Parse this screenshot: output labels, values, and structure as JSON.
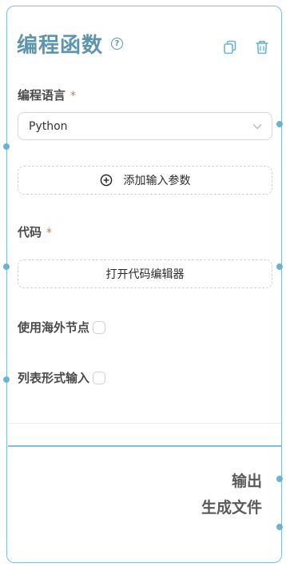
{
  "node": {
    "title": "编程函数",
    "help_icon": "question-circle-icon",
    "toolbar": {
      "copy_icon": "copy-icon",
      "delete_icon": "trash-icon"
    }
  },
  "language": {
    "label": "编程语言",
    "required_mark": "*",
    "selected": "Python"
  },
  "add_param": {
    "icon": "plus-circle-icon",
    "label": "添加输入参数"
  },
  "code": {
    "label": "代码",
    "required_mark": "*",
    "open_editor_label": "打开代码编辑器"
  },
  "options": [
    {
      "label": "使用海外节点",
      "checked": false
    },
    {
      "label": "列表形式输入",
      "checked": false
    }
  ],
  "outputs": [
    {
      "label": "输出"
    },
    {
      "label": "生成文件"
    }
  ],
  "colors": {
    "accent": "#5d95ad",
    "border": "#7fc0d8",
    "handle": "#6cb3d0",
    "required": "#e06a4e"
  }
}
